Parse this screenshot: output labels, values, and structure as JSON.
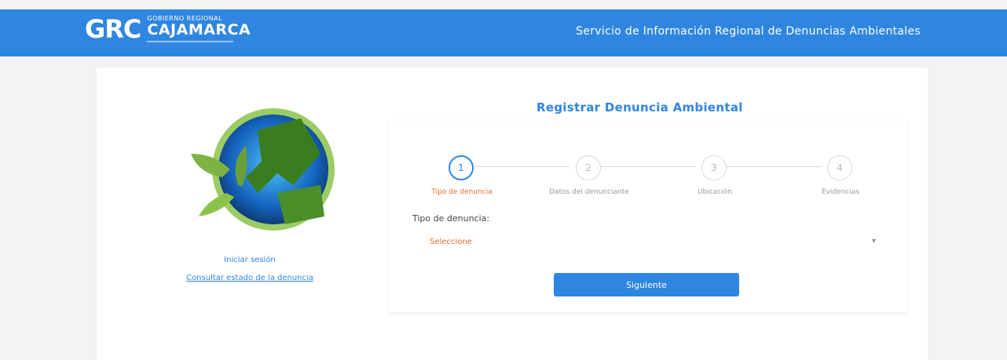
{
  "header": {
    "logo_mark": "GRC",
    "logo_line1": "GOBIERNO REGIONAL",
    "logo_line2": "CAJAMARCA",
    "title": "Servicio de Información Regional de Denuncias Ambientales"
  },
  "left": {
    "link1": "Iniciar sesión",
    "link2": "Consultar estado de la denuncia"
  },
  "form": {
    "title": "Registrar Denuncia Ambiental",
    "steps": [
      {
        "number": "1",
        "label": "Tipo de denuncia"
      },
      {
        "number": "2",
        "label": "Datos del denunciante"
      },
      {
        "number": "3",
        "label": "Ubicación"
      },
      {
        "number": "4",
        "label": "Evidencias"
      }
    ],
    "field_label": "Tipo de denuncia:",
    "select_value": "Seleccione",
    "next_button": "Siguiente"
  },
  "colors": {
    "primary": "#2f86e0",
    "accent": "#e06b2f"
  }
}
